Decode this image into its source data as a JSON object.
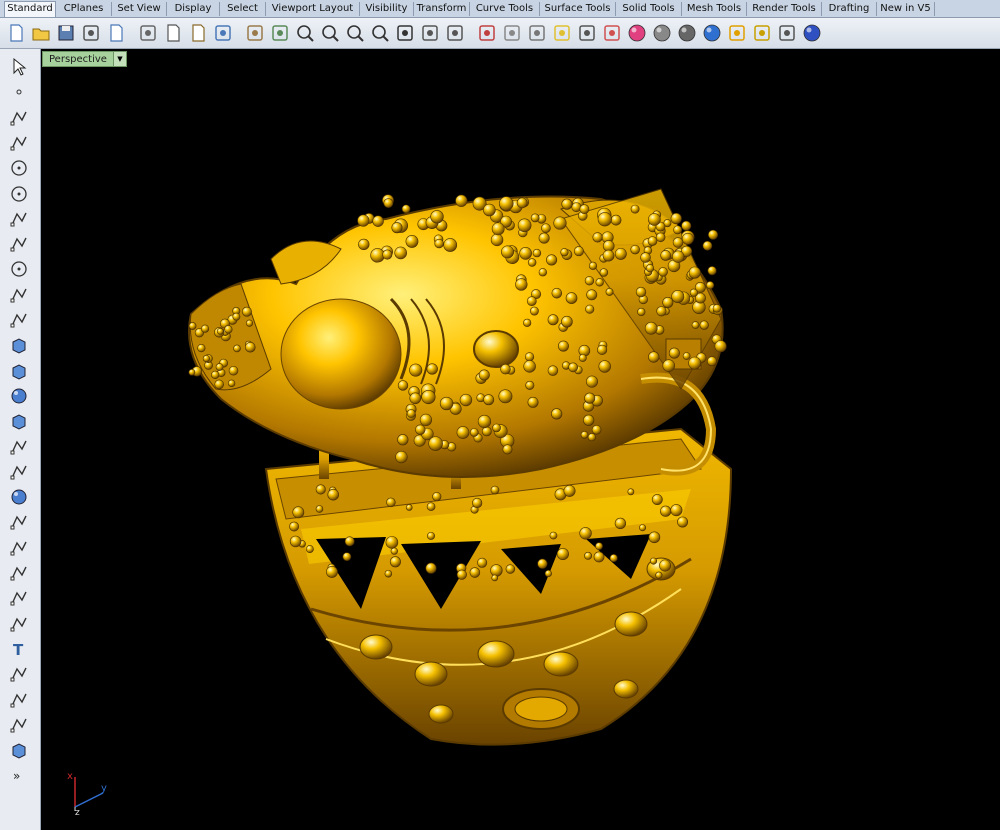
{
  "tabs": [
    "Standard",
    "CPlanes",
    "Set View",
    "Display",
    "Select",
    "Viewport Layout",
    "Visibility",
    "Transform",
    "Curve Tools",
    "Surface Tools",
    "Solid Tools",
    "Mesh Tools",
    "Render Tools",
    "Drafting",
    "New in V5"
  ],
  "active_tab": "Standard",
  "toolbar_icons": [
    "new-file-icon",
    "open-folder-icon",
    "save-icon",
    "print-icon",
    "import-icon",
    "cut-icon",
    "copy-icon",
    "paste-icon",
    "undo-icon",
    "pan-hand-icon",
    "rotate-view-icon",
    "zoom-icon",
    "zoom-window-icon",
    "zoom-extents-icon",
    "zoom-selected-icon",
    "undo-view-icon",
    "four-viewports-icon",
    "grid-options-icon",
    "car-icon",
    "point-on-icon",
    "osnap-icon",
    "layer-bulb-icon",
    "lock-icon",
    "properties-icon",
    "color-wheel-icon",
    "render-sphere-icon",
    "shaded-sphere-icon",
    "blue-sphere-icon",
    "light-pencil-icon",
    "options-gear-icon",
    "dimension-icon",
    "help-icon"
  ],
  "left_icons": [
    "select-arrow-icon",
    "point-icon",
    "polyline-icon",
    "curve-icon",
    "circle-icon",
    "ellipse-icon",
    "polygon-icon",
    "rectangle-icon",
    "arc-icon",
    "fillet-icon",
    "surface-icon",
    "extrude-icon",
    "box-icon",
    "sphere-icon",
    "cylinder-icon",
    "plane-icon",
    "transform-icon",
    "boolean-icon",
    "split-icon",
    "dimension-left-icon",
    "group-icon",
    "analyze-icon",
    "offset-icon",
    "text-icon",
    "array-icon",
    "block-icon",
    "edit-icon",
    "mesh-box-icon",
    "more-icon"
  ],
  "viewport": {
    "title": "Perspective",
    "dropdown_glyph": "▼"
  },
  "axes": {
    "x": "x",
    "y": "y",
    "z": "z"
  },
  "colors": {
    "gold": "#e0a800",
    "gold_light": "#ffd84a",
    "gold_dark": "#7a4e00",
    "axis_x": "#c8282a",
    "axis_y": "#2f6fd0",
    "axis_z": "#dddddd"
  }
}
